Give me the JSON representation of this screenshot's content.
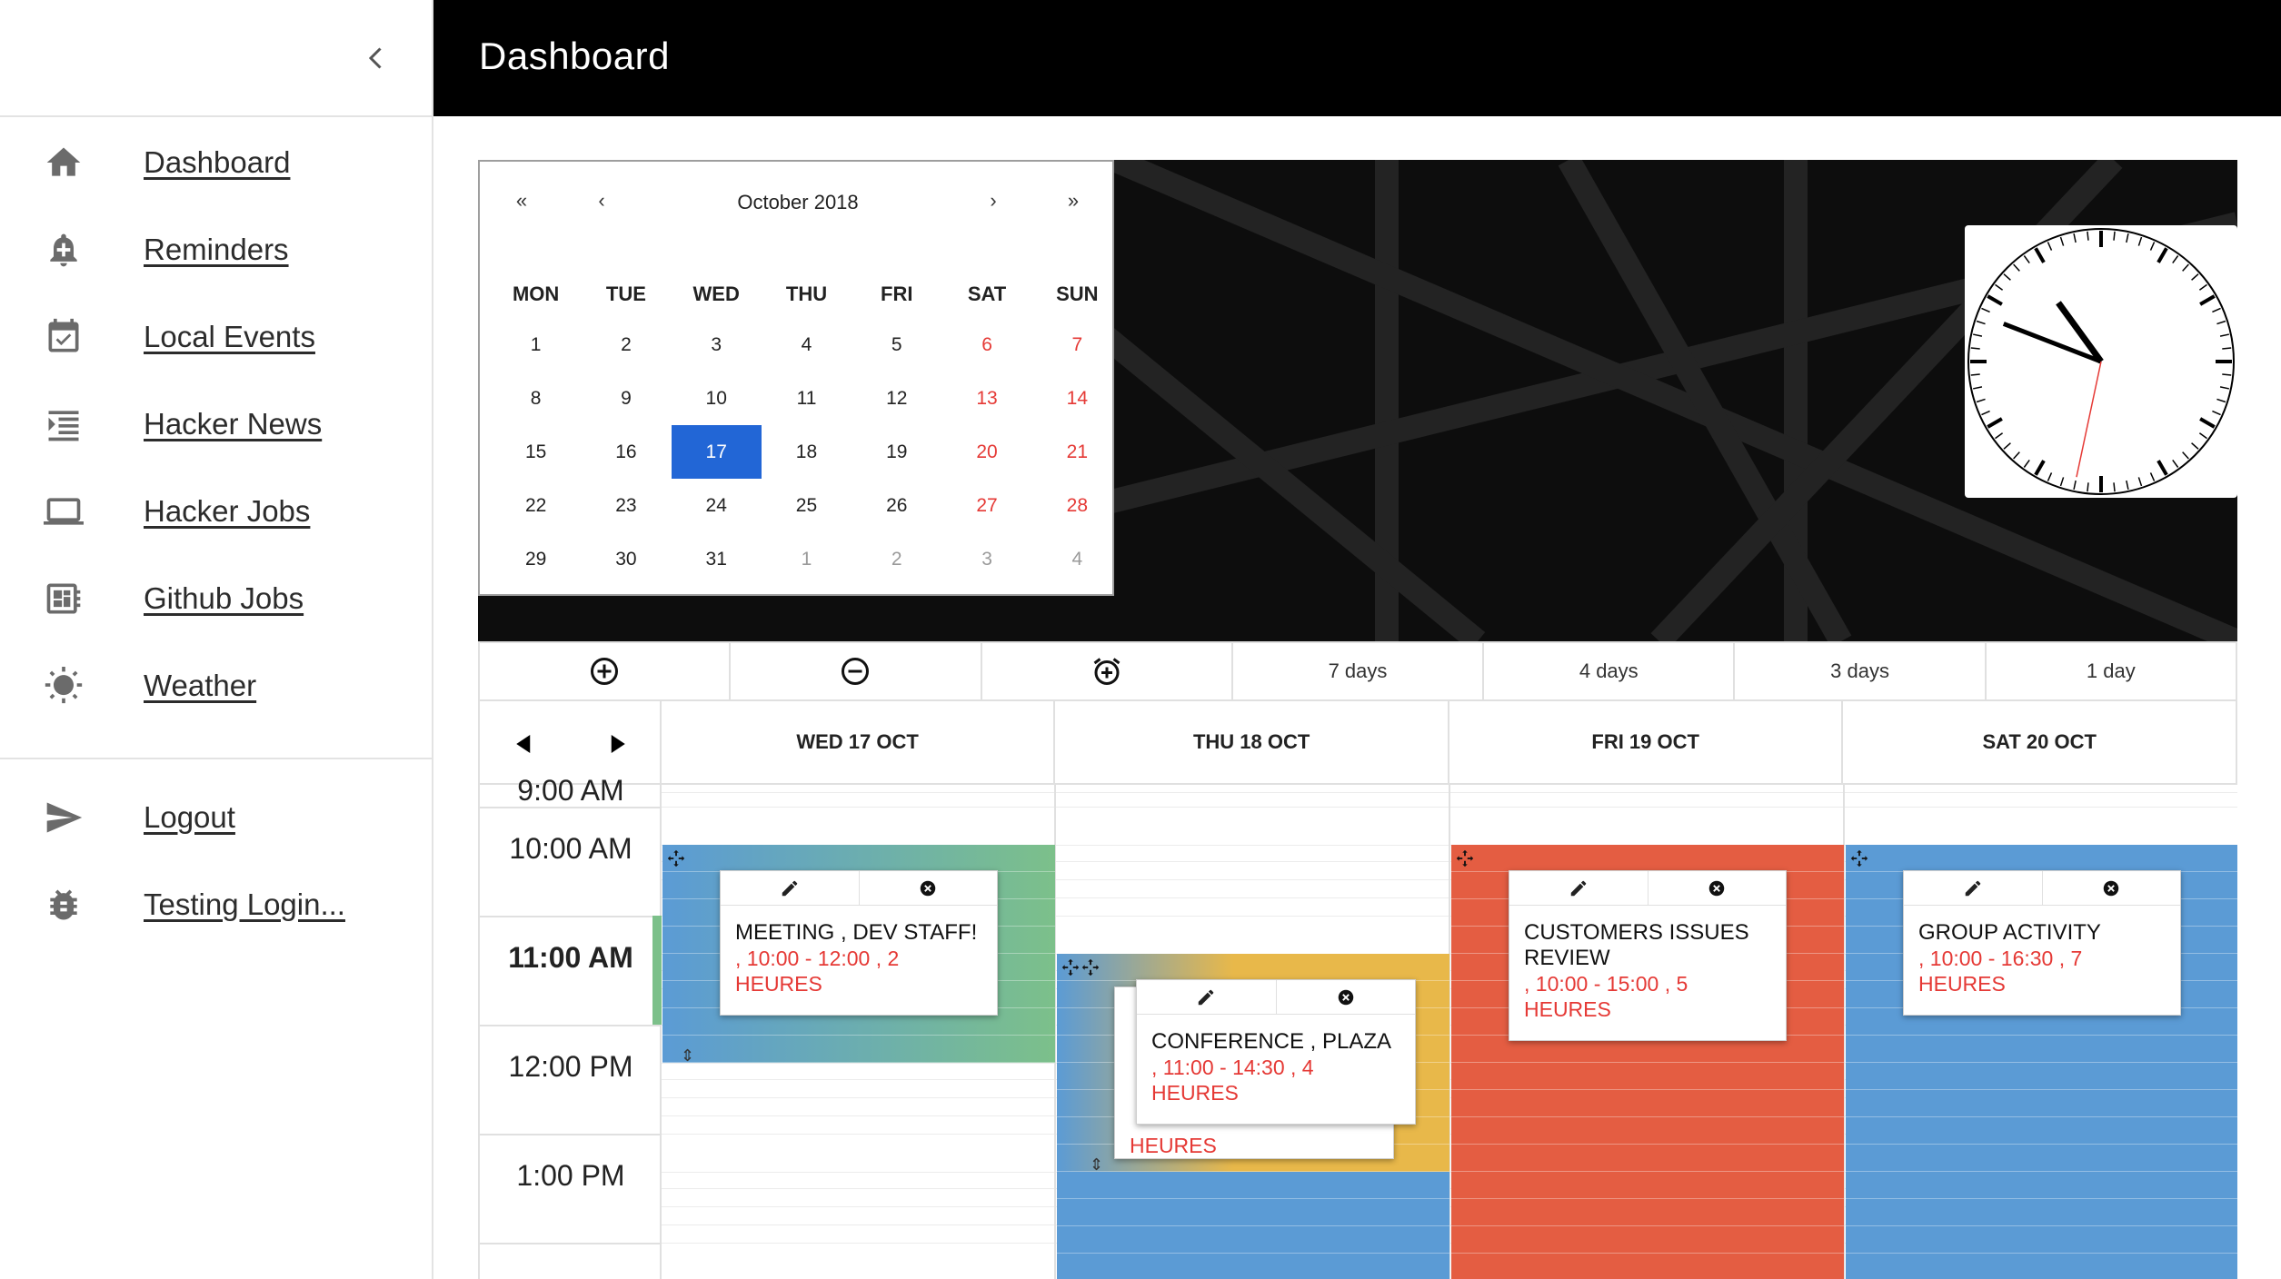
{
  "sidebar": {
    "items": [
      {
        "label": "Dashboard",
        "icon": "home-icon"
      },
      {
        "label": "Reminders",
        "icon": "bell-icon"
      },
      {
        "label": "Local Events",
        "icon": "calendar-check-icon"
      },
      {
        "label": "Hacker News",
        "icon": "list-icon"
      },
      {
        "label": "Hacker Jobs",
        "icon": "laptop-icon"
      },
      {
        "label": "Github Jobs",
        "icon": "grid-icon"
      },
      {
        "label": "Weather",
        "icon": "sun-icon"
      }
    ],
    "secondary": [
      {
        "label": "Logout",
        "icon": "send-icon"
      },
      {
        "label": "Testing Login...",
        "icon": "bug-icon"
      }
    ]
  },
  "header": {
    "title": "Dashboard"
  },
  "mini_calendar": {
    "title": "October 2018",
    "nav": {
      "prev_year": "«",
      "prev_month": "‹",
      "next_month": "›",
      "next_year": "»"
    },
    "weekdays": [
      "MON",
      "TUE",
      "WED",
      "THU",
      "FRI",
      "SAT",
      "SUN"
    ],
    "weeks": [
      [
        "1",
        "2",
        "3",
        "4",
        "5",
        "6",
        "7"
      ],
      [
        "8",
        "9",
        "10",
        "11",
        "12",
        "13",
        "14"
      ],
      [
        "15",
        "16",
        "17",
        "18",
        "19",
        "20",
        "21"
      ],
      [
        "22",
        "23",
        "24",
        "25",
        "26",
        "27",
        "28"
      ],
      [
        "29",
        "30",
        "31",
        "1",
        "2",
        "3",
        "4"
      ]
    ],
    "selected": "17",
    "weekend_color": "#e53935",
    "selected_color": "#2266d6"
  },
  "clock": {
    "hours": 10,
    "minutes": 48,
    "seconds": 32
  },
  "toolbar": {
    "add_icon": "add-circle-icon",
    "remove_icon": "remove-circle-icon",
    "alarm_icon": "alarm-add-icon",
    "views": [
      "7 days",
      "4 days",
      "3 days",
      "1 day"
    ]
  },
  "week": {
    "days": [
      "WED 17 OCT",
      "THU 18 OCT",
      "FRI 19 OCT",
      "SAT 20 OCT"
    ],
    "times": [
      "9:00 AM",
      "10:00 AM",
      "11:00 AM",
      "12:00 PM",
      "1:00 PM"
    ],
    "events": [
      {
        "title": "MEETING , DEV STAFF!",
        "time": ", 10:00 - 12:00 , 2 HEURES"
      },
      {
        "title": "CONFERENCE , PLAZA",
        "time": ", 11:00 - 14:30 , 4 HEURES"
      },
      {
        "title": "CUSTOMERS ISSUES REVIEW",
        "time": ", 10:00 - 15:00 , 5 HEURES"
      },
      {
        "title": "GROUP ACTIVITY",
        "time": ", 10:00 - 16:30 , 7 HEURES"
      },
      {
        "hidden_fragment": "HEURES"
      }
    ],
    "colors": {
      "blue": "#5b9bd5",
      "green": "#7cc08a",
      "orange": "#e45d42",
      "yellow": "#e8b84a"
    }
  }
}
